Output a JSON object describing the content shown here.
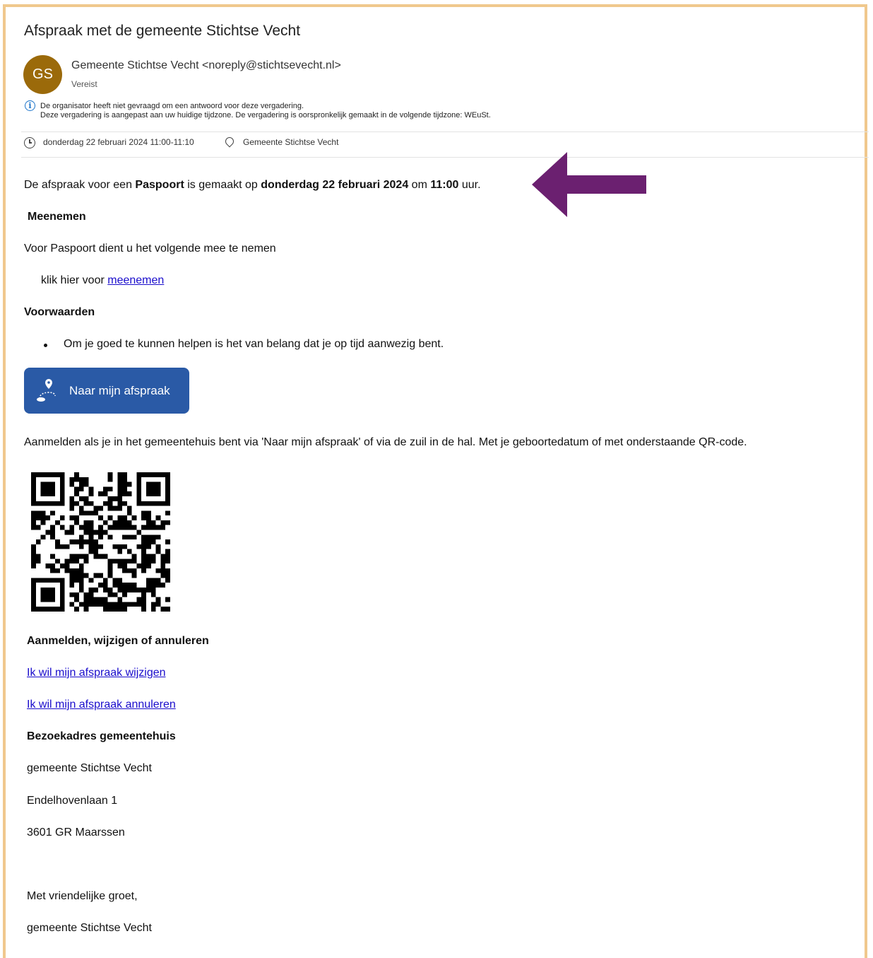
{
  "email": {
    "subject": "Afspraak met de gemeente Stichtse Vecht",
    "avatar_initials": "GS",
    "sender": "Gemeente Stichtse Vecht <noreply@stichtsevecht.nl>",
    "attendance": "Vereist",
    "info_line1": "De organisator heeft niet gevraagd om een antwoord voor deze vergadering.",
    "info_line2": "Deze vergadering is aangepast aan uw huidige tijdzone. De vergadering is oorspronkelijk gemaakt in de volgende tijdzone: WEuSt.",
    "datetime": "donderdag 22 februari 2024 11:00-11:10",
    "location": "Gemeente Stichtse Vecht"
  },
  "body": {
    "intro_pre": "De afspraak voor een ",
    "intro_product": "Paspoort",
    "intro_mid": " is gemaakt op ",
    "intro_date": "donderdag 22 februari 2024",
    "intro_mid2": " om ",
    "intro_time": "11:00",
    "intro_post": " uur.",
    "bring_heading": "Meenemen",
    "bring_text": "Voor Paspoort dient u het volgende mee te nemen",
    "click_pre": "klik hier voor ",
    "click_link": "meenemen",
    "conditions_heading": "Voorwaarden",
    "condition_1": "Om je goed te kunnen helpen is het van belang dat je op tijd aanwezig bent.",
    "cta_label": "Naar mijn afspraak",
    "checkin_text": "Aanmelden als je in het gemeentehuis bent via 'Naar mijn afspraak' of via de zuil in de hal.  Met je geboortedatum of met onderstaande QR-code.",
    "manage_heading": "Aanmelden, wijzigen of annuleren",
    "change_link": "Ik wil mijn afspraak wijzigen",
    "cancel_link": "Ik wil mijn afspraak annuleren",
    "address_heading": "Bezoekadres gemeentehuis",
    "address_line1": "gemeente Stichtse Vecht",
    "address_line2": "Endelhovenlaan 1",
    "address_line3": "3601 GR Maarssen",
    "closing": "Met vriendelijke groet,",
    "signature": "gemeente Stichtse Vecht"
  },
  "colors": {
    "frame": "#f0c88d",
    "avatar": "#9b6a0a",
    "cta": "#2a5aa6",
    "arrow": "#6b2070",
    "link": "#1a0dcc"
  }
}
